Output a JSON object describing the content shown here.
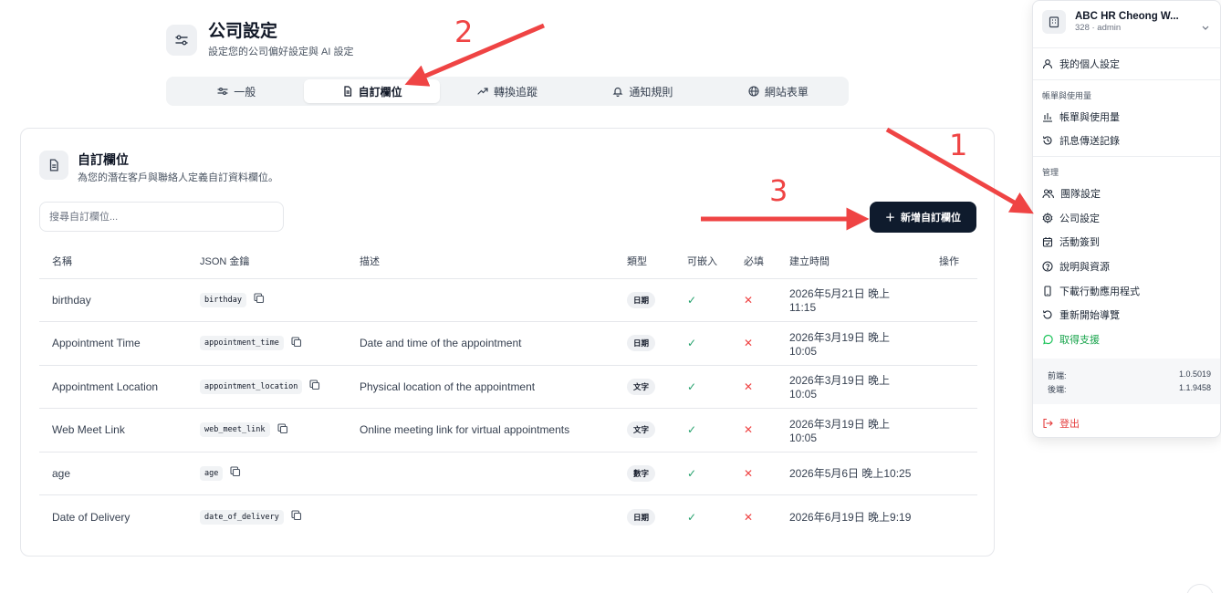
{
  "header": {
    "title": "公司設定",
    "subtitle": "設定您的公司偏好設定與 AI 設定"
  },
  "tabs": [
    {
      "label": "一般",
      "icon": "sliders-icon",
      "active": false
    },
    {
      "label": "自訂欄位",
      "icon": "document-icon",
      "active": true
    },
    {
      "label": "轉換追蹤",
      "icon": "trend-icon",
      "active": false
    },
    {
      "label": "通知規則",
      "icon": "bell-icon",
      "active": false
    },
    {
      "label": "網站表單",
      "icon": "globe-icon",
      "active": false
    }
  ],
  "card": {
    "title": "自訂欄位",
    "subtitle": "為您的潛在客戶與聯絡人定義自訂資料欄位。",
    "search_placeholder": "搜尋自訂欄位...",
    "add_button": "新增自訂欄位"
  },
  "table": {
    "columns": [
      "名稱",
      "JSON 金鑰",
      "描述",
      "類型",
      "可嵌入",
      "必填",
      "建立時間",
      "操作"
    ],
    "rows": [
      {
        "name": "birthday",
        "key": "birthday",
        "description": "",
        "type": "日期",
        "embeddable": "✓",
        "required": "✕",
        "created": "2026年5月21日 晚上11:15"
      },
      {
        "name": "Appointment Time",
        "key": "appointment_time",
        "description": "Date and time of the appointment",
        "type": "日期",
        "embeddable": "✓",
        "required": "✕",
        "created": "2026年3月19日 晚上10:05"
      },
      {
        "name": "Appointment Location",
        "key": "appointment_location",
        "description": "Physical location of the appointment",
        "type": "文字",
        "embeddable": "✓",
        "required": "✕",
        "created": "2026年3月19日 晚上10:05"
      },
      {
        "name": "Web Meet Link",
        "key": "web_meet_link",
        "description": "Online meeting link for virtual appointments",
        "type": "文字",
        "embeddable": "✓",
        "required": "✕",
        "created": "2026年3月19日 晚上10:05"
      },
      {
        "name": "age",
        "key": "age",
        "description": "",
        "type": "數字",
        "embeddable": "✓",
        "required": "✕",
        "created": "2026年5月6日 晚上10:25"
      },
      {
        "name": "Date of Delivery",
        "key": "date_of_delivery",
        "description": "",
        "type": "日期",
        "embeddable": "✓",
        "required": "✕",
        "created": "2026年6月19日 晚上9:19"
      }
    ]
  },
  "menu": {
    "org_name": "ABC HR Cheong W...",
    "org_sub": "328 · admin",
    "profile": "我的個人設定",
    "billing_section": "帳單與使用量",
    "billing": "帳單與使用量",
    "message_log": "訊息傳送記錄",
    "manage_section": "管理",
    "team": "團隊設定",
    "company": "公司設定",
    "checkin": "活動簽到",
    "help": "說明與資源",
    "download_app": "下載行動應用程式",
    "restart_tour": "重新開始導覽",
    "support": "取得支援",
    "frontend_label": "前端:",
    "frontend_version": "1.0.5019",
    "backend_label": "後端:",
    "backend_version": "1.1.9458",
    "logout": "登出"
  },
  "annotations": {
    "one": "1",
    "two": "2",
    "three": "3",
    "color": "#ef4444"
  },
  "colors": {
    "primary_button": "#0f1b2d",
    "check": "#22a06b",
    "cross": "#ef4444",
    "support": "#22c55e"
  }
}
